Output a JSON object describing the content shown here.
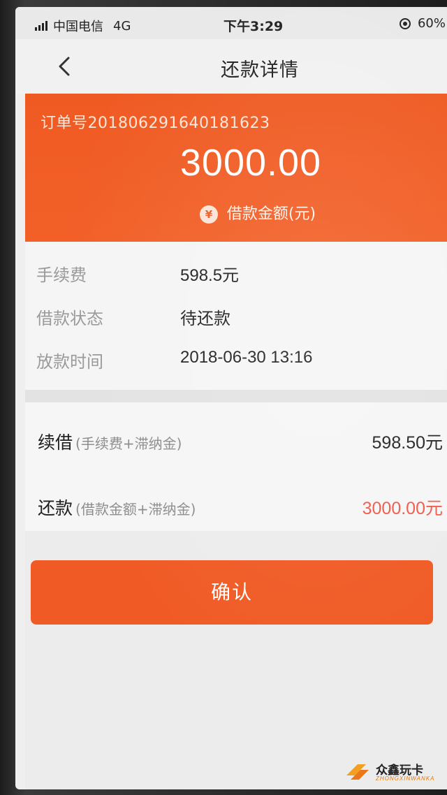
{
  "status_bar": {
    "carrier": "中国电信",
    "network": "4G",
    "time": "下午3:29",
    "battery": "60%"
  },
  "nav": {
    "title": "还款详情"
  },
  "header": {
    "order_number": "订单号201806291640181623",
    "amount": "3000.00",
    "yen_symbol": "¥",
    "amount_caption": "借款金额(元)"
  },
  "info": [
    {
      "label": "手续费",
      "value": "598.5元"
    },
    {
      "label": "借款状态",
      "value": "待还款"
    },
    {
      "label": "放款时间",
      "value": "2018-06-30 13:16"
    }
  ],
  "options": [
    {
      "title": "续借",
      "subtitle": "(手续费+滞纳金)",
      "amount": "598.50元"
    },
    {
      "title": "还款",
      "subtitle": "(借款金额+滞纳金)",
      "amount": "3000.00元"
    }
  ],
  "confirm_label": "确认",
  "watermark": {
    "name": "众鑫玩卡",
    "sub": "ZHONGXINWANKA"
  },
  "colors": {
    "brand_orange": "#f05a24",
    "repay_red": "#ef5a4a"
  }
}
